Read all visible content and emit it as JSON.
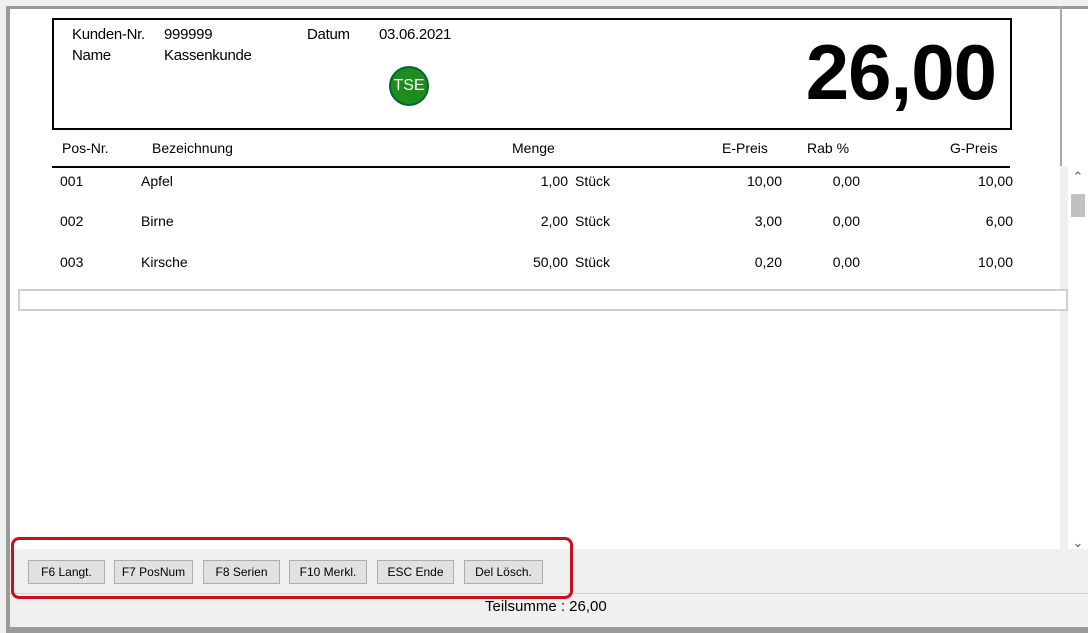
{
  "header": {
    "customer_no_label": "Kunden-Nr.",
    "customer_no": "999999",
    "name_label": "Name",
    "name": "Kassenkunde",
    "date_label": "Datum",
    "date": "03.06.2021",
    "tse_badge": "TSE",
    "total": "26,00"
  },
  "columns": {
    "pos": "Pos-Nr.",
    "description": "Bezeichnung",
    "quantity": "Menge",
    "unit_price": "E-Preis",
    "discount": "Rab %",
    "total_price": "G-Preis"
  },
  "rows": [
    {
      "pos": "001",
      "description": "Apfel",
      "quantity": "1,00",
      "unit": "Stück",
      "unit_price": "10,00",
      "discount": "0,00",
      "total_price": "10,00"
    },
    {
      "pos": "002",
      "description": "Birne",
      "quantity": "2,00",
      "unit": "Stück",
      "unit_price": "3,00",
      "discount": "0,00",
      "total_price": "6,00"
    },
    {
      "pos": "003",
      "description": "Kirsche",
      "quantity": "50,00",
      "unit": "Stück",
      "unit_price": "0,20",
      "discount": "0,00",
      "total_price": "10,00"
    }
  ],
  "toolbar": {
    "f6": "F6 Langt.",
    "f7": "F7 PosNum",
    "f8": "F8 Serien",
    "f10": "F10 Merkl.",
    "esc": "ESC Ende",
    "del": "Del Lösch."
  },
  "status": {
    "subtotal": "Teilsumme : 26,00"
  },
  "colors": {
    "tse_green": "#1d8d1d",
    "highlight_red": "#c8101c"
  }
}
